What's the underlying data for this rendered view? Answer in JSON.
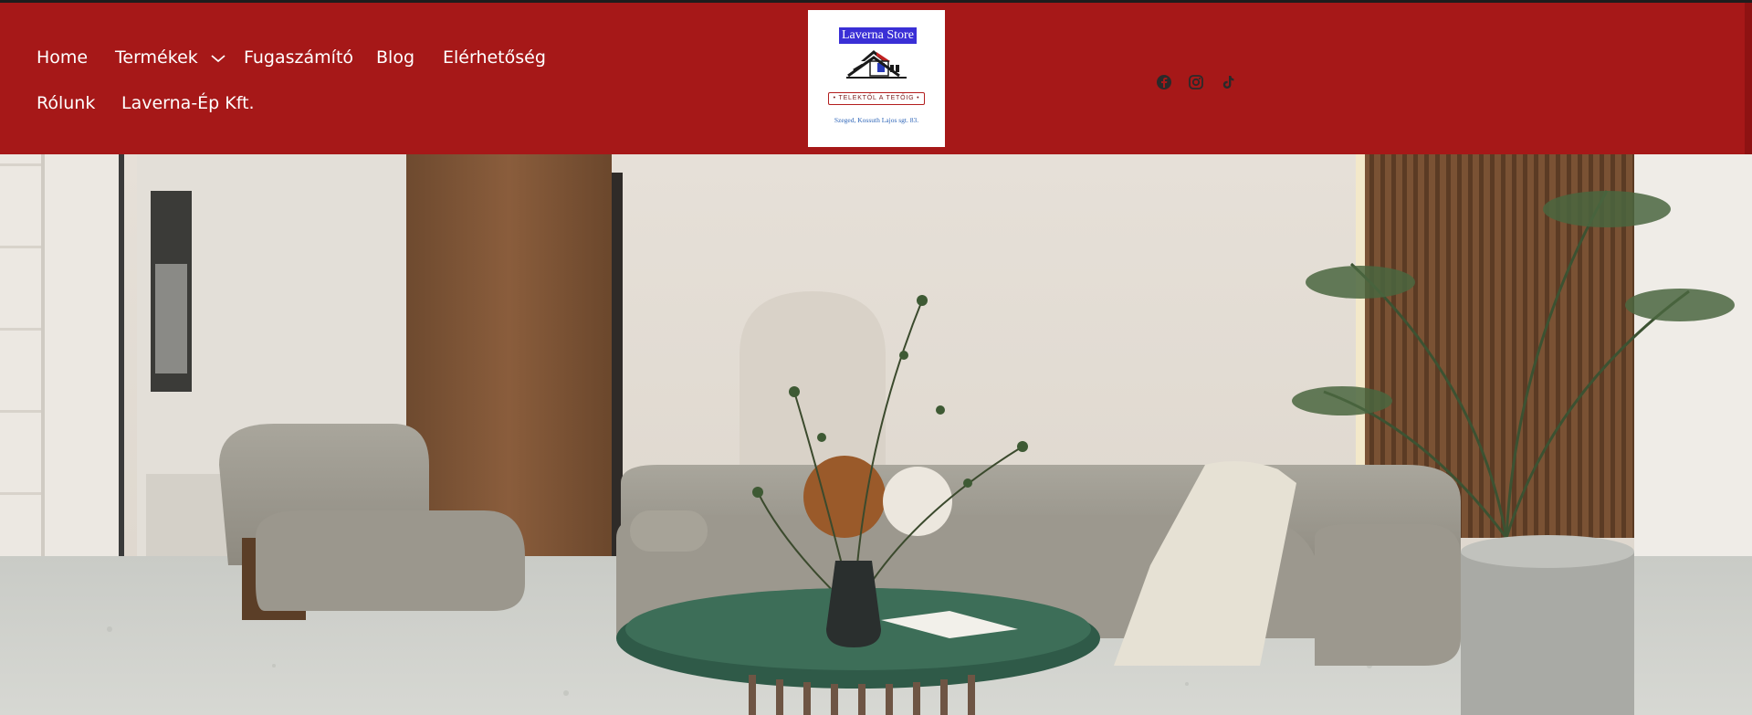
{
  "nav": {
    "items": [
      {
        "label": "Home"
      },
      {
        "label": "Termékek",
        "has_dropdown": true
      },
      {
        "label": "Fugaszámító"
      },
      {
        "label": "Blog"
      },
      {
        "label": "Elérhetőség"
      },
      {
        "label": "Rólunk"
      },
      {
        "label": "Laverna-Ép Kft."
      }
    ]
  },
  "logo": {
    "title": "Laverna Store",
    "motto": "• TELEKTŐL A TETŐIG •",
    "address": "Szeged, Kossuth Lajos sgt. 83."
  },
  "social": [
    "facebook-icon",
    "instagram-icon",
    "tiktok-icon"
  ],
  "colors": {
    "header_bg": "#a61818",
    "nav_text": "#ffffff",
    "logo_title_bg": "#3a2fd6"
  }
}
